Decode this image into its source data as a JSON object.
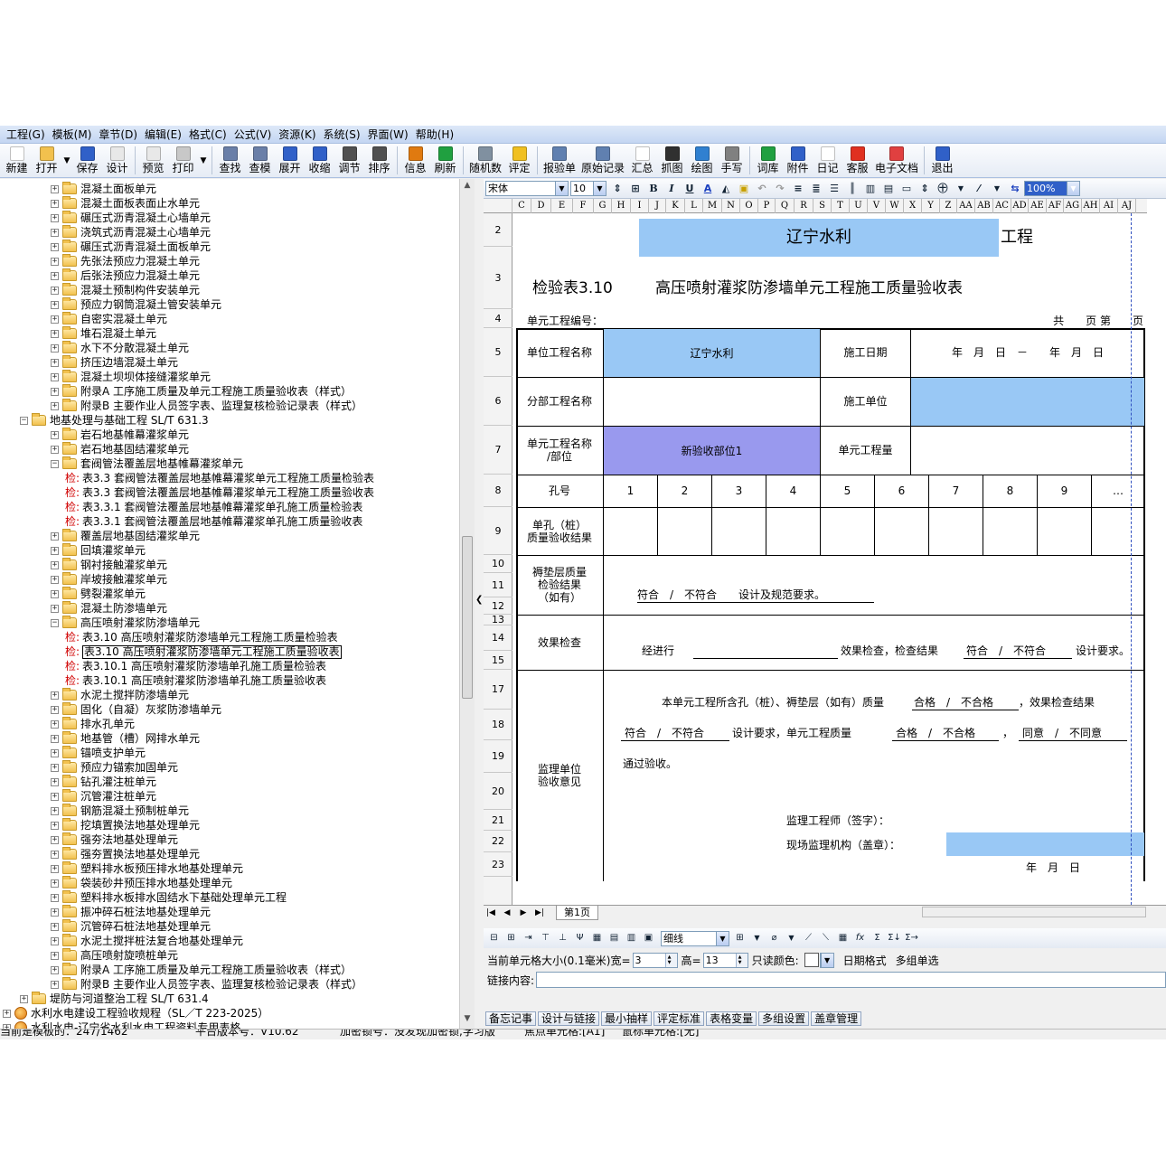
{
  "menu": [
    "工程(G)",
    "模板(M)",
    "章节(D)",
    "编辑(E)",
    "格式(C)",
    "公式(V)",
    "资源(K)",
    "系统(S)",
    "界面(W)",
    "帮助(H)"
  ],
  "toolbar": {
    "new": "新建",
    "open": "打开",
    "save": "保存",
    "design": "设计",
    "preview": "预览",
    "print": "打印",
    "find": "查找",
    "check_tpl": "查模",
    "expand": "展开",
    "collapse": "收缩",
    "adjust": "调节",
    "sort": "排序",
    "info": "信息",
    "refresh": "刷新",
    "random": "随机数",
    "evaluate": "评定",
    "report": "报验单",
    "raw_record": "原始记录",
    "summary": "汇总",
    "capture": "抓图",
    "draw": "绘图",
    "handwrite": "手写",
    "lexicon": "词库",
    "attach": "附件",
    "diary": "日记",
    "service": "客服",
    "edoc": "电子文档",
    "exit": "退出"
  },
  "tree": [
    {
      "indent": 1,
      "type": "folder",
      "text": "混凝土面板单元"
    },
    {
      "indent": 1,
      "type": "folder",
      "text": "混凝土面板表面止水单元"
    },
    {
      "indent": 1,
      "type": "folder",
      "text": "碾压式沥青混凝土心墙单元"
    },
    {
      "indent": 1,
      "type": "folder",
      "text": "浇筑式沥青混凝土心墙单元"
    },
    {
      "indent": 1,
      "type": "folder",
      "text": "碾压式沥青混凝土面板单元"
    },
    {
      "indent": 1,
      "type": "folder",
      "text": "先张法预应力混凝土单元"
    },
    {
      "indent": 1,
      "type": "folder",
      "text": "后张法预应力混凝土单元"
    },
    {
      "indent": 1,
      "type": "folder",
      "text": "混凝土预制构件安装单元"
    },
    {
      "indent": 1,
      "type": "folder",
      "text": "预应力钢筒混凝土管安装单元"
    },
    {
      "indent": 1,
      "type": "folder",
      "text": "自密实混凝土单元"
    },
    {
      "indent": 1,
      "type": "folder",
      "text": "堆石混凝土单元"
    },
    {
      "indent": 1,
      "type": "folder",
      "text": "水下不分散混凝土单元"
    },
    {
      "indent": 1,
      "type": "folder",
      "text": "挤压边墙混凝土单元"
    },
    {
      "indent": 1,
      "type": "folder",
      "text": "混凝土坝坝体接缝灌浆单元"
    },
    {
      "indent": 1,
      "type": "folder",
      "text": "附录A 工序施工质量及单元工程施工质量验收表（样式）"
    },
    {
      "indent": 1,
      "type": "folder",
      "text": "附录B 主要作业人员签字表、监理复核检验记录表（样式）"
    },
    {
      "indent": 0,
      "type": "folder-open",
      "text": "地基处理与基础工程 SL/T 631.3"
    },
    {
      "indent": 1,
      "type": "folder",
      "text": "岩石地基帷幕灌浆单元"
    },
    {
      "indent": 1,
      "type": "folder",
      "text": "岩石地基固结灌浆单元"
    },
    {
      "indent": 1,
      "type": "folder-open",
      "text": "套阀管法覆盖层地基帷幕灌浆单元"
    },
    {
      "indent": 2,
      "type": "leaf",
      "prefix": "检:",
      "text": "表3.3 套阀管法覆盖层地基帷幕灌浆单元工程施工质量检验表"
    },
    {
      "indent": 2,
      "type": "leaf",
      "prefix": "检:",
      "text": "表3.3 套阀管法覆盖层地基帷幕灌浆单元工程施工质量验收表"
    },
    {
      "indent": 2,
      "type": "leaf",
      "prefix": "检:",
      "text": "表3.3.1 套阀管法覆盖层地基帷幕灌浆单孔施工质量检验表"
    },
    {
      "indent": 2,
      "type": "leaf",
      "prefix": "检:",
      "text": "表3.3.1 套阀管法覆盖层地基帷幕灌浆单孔施工质量验收表"
    },
    {
      "indent": 1,
      "type": "folder",
      "text": "覆盖层地基固结灌浆单元"
    },
    {
      "indent": 1,
      "type": "folder",
      "text": "回填灌浆单元"
    },
    {
      "indent": 1,
      "type": "folder",
      "text": "钢衬接触灌浆单元"
    },
    {
      "indent": 1,
      "type": "folder",
      "text": "岸坡接触灌浆单元"
    },
    {
      "indent": 1,
      "type": "folder",
      "text": "劈裂灌浆单元"
    },
    {
      "indent": 1,
      "type": "folder",
      "text": "混凝土防渗墙单元"
    },
    {
      "indent": 1,
      "type": "folder-open",
      "text": "高压喷射灌浆防渗墙单元"
    },
    {
      "indent": 2,
      "type": "leaf",
      "prefix": "检:",
      "text": "表3.10 高压喷射灌浆防渗墙单元工程施工质量检验表"
    },
    {
      "indent": 2,
      "type": "leaf",
      "prefix": "检:",
      "text": "表3.10 高压喷射灌浆防渗墙单元工程施工质量验收表",
      "selected": true
    },
    {
      "indent": 2,
      "type": "leaf",
      "prefix": "检:",
      "text": "表3.10.1 高压喷射灌浆防渗墙单孔施工质量检验表"
    },
    {
      "indent": 2,
      "type": "leaf",
      "prefix": "检:",
      "text": "表3.10.1 高压喷射灌浆防渗墙单孔施工质量验收表"
    },
    {
      "indent": 1,
      "type": "folder",
      "text": "水泥土搅拌防渗墙单元"
    },
    {
      "indent": 1,
      "type": "folder",
      "text": "固化（自凝）灰浆防渗墙单元"
    },
    {
      "indent": 1,
      "type": "folder",
      "text": "排水孔单元"
    },
    {
      "indent": 1,
      "type": "folder",
      "text": "地基管（槽）网排水单元"
    },
    {
      "indent": 1,
      "type": "folder",
      "text": "锚喷支护单元"
    },
    {
      "indent": 1,
      "type": "folder",
      "text": "预应力锚索加固单元"
    },
    {
      "indent": 1,
      "type": "folder",
      "text": "钻孔灌注桩单元"
    },
    {
      "indent": 1,
      "type": "folder",
      "text": "沉管灌注桩单元"
    },
    {
      "indent": 1,
      "type": "folder",
      "text": "钢筋混凝土预制桩单元"
    },
    {
      "indent": 1,
      "type": "folder",
      "text": "挖填置换法地基处理单元"
    },
    {
      "indent": 1,
      "type": "folder",
      "text": "强夯法地基处理单元"
    },
    {
      "indent": 1,
      "type": "folder",
      "text": "强夯置换法地基处理单元"
    },
    {
      "indent": 1,
      "type": "folder",
      "text": "塑料排水板预压排水地基处理单元"
    },
    {
      "indent": 1,
      "type": "folder",
      "text": "袋装砂井预压排水地基处理单元"
    },
    {
      "indent": 1,
      "type": "folder",
      "text": "塑料排水板排水固结水下基础处理单元工程"
    },
    {
      "indent": 1,
      "type": "folder",
      "text": "振冲碎石桩法地基处理单元"
    },
    {
      "indent": 1,
      "type": "folder",
      "text": "沉管碎石桩法地基处理单元"
    },
    {
      "indent": 1,
      "type": "folder",
      "text": "水泥土搅拌桩法复合地基处理单元"
    },
    {
      "indent": 1,
      "type": "folder",
      "text": "高压喷射旋喷桩单元"
    },
    {
      "indent": 1,
      "type": "folder",
      "text": "附录A 工序施工质量及单元工程施工质量验收表（样式）"
    },
    {
      "indent": 1,
      "type": "folder",
      "text": "附录B 主要作业人员签字表、监理复核检验记录表（样式）"
    },
    {
      "indent": 0,
      "type": "folder",
      "text": "堤防与河道整治工程 SL/T 631.4"
    },
    {
      "indent": -1,
      "type": "globe",
      "text": "水利水电建设工程验收规程（SL／T 223-2025）"
    },
    {
      "indent": -1,
      "type": "globe",
      "text": "水利水电-辽宁省水利水电工程资料专用表格"
    }
  ],
  "format_bar": {
    "font": "宋体",
    "size": "10",
    "zoom": "100%"
  },
  "columns": [
    "C",
    "D",
    "E",
    "F",
    "G",
    "H",
    "I",
    "J",
    "K",
    "L",
    "M",
    "N",
    "O",
    "P",
    "Q",
    "R",
    "S",
    "T",
    "U",
    "V",
    "W",
    "X",
    "Y",
    "Z",
    "AA",
    "AB",
    "AC",
    "AD",
    "AE",
    "AF",
    "AG",
    "AH",
    "AI",
    "AJ"
  ],
  "rows": [
    "2",
    "3",
    "4",
    "5",
    "6",
    "7",
    "8",
    "9",
    "10",
    "11",
    "12",
    "13",
    "14",
    "15",
    "17",
    "18",
    "19",
    "20",
    "21",
    "22",
    "23"
  ],
  "form": {
    "header_name": "辽宁水利",
    "header_suffix": "工程",
    "title_no": "检验表3.10",
    "title": "高压喷射灌浆防渗墙单元工程施工质量验收表",
    "unit_no_label": "单元工程编号：",
    "page_label": "共　　页 第　　页",
    "unit_project_label": "单位工程名称",
    "unit_project_value": "辽宁水利",
    "construction_date_label": "施工日期",
    "construction_date_value": "年　月　日　－　　年　月　日",
    "sub_project_label": "分部工程名称",
    "contractor_label": "施工单位",
    "element_label": "单元工程名称\n/部位",
    "element_value": "新验收部位1",
    "quantity_label": "单元工程量",
    "hole_label": "孔号",
    "holes": [
      "1",
      "2",
      "3",
      "4",
      "5",
      "6",
      "7",
      "8",
      "9",
      "…"
    ],
    "single_hole_label": "单孔（桩）\n质量验收结果",
    "cushion_label": "褥垫层质量\n检验结果\n（如有）",
    "cushion_text": "符合　/　不符合　　设计及规范要求。",
    "effect_label": "效果检查",
    "effect_text_1": "经进行",
    "effect_text_2": "效果检查，检查结果",
    "effect_text_3": "符合　/　不符合",
    "effect_text_4": "设计要求。",
    "supervisor_label": "监理单位\n验收意见",
    "opinion_1a": "本单元工程所含孔（桩）、褥垫层（如有）质量",
    "opinion_1b": "合格　/　不合格",
    "opinion_1c": "，效果检查结果",
    "opinion_2a": "符合　/　不符合",
    "opinion_2b": "设计要求，单元工程质量",
    "opinion_2c": "合格　/　不合格",
    "opinion_2d": "，",
    "opinion_2e": "同意　/　不同意",
    "opinion_3": "通过验收。",
    "engineer_sign": "监理工程师（签字）：",
    "org_seal": "现场监理机构（盖章）：",
    "date": "年　月　日"
  },
  "sheet_tab": "第1页",
  "bottom_bar": {
    "line_style": "细线"
  },
  "size_bar": {
    "label": "当前单元格大小(0.1毫米)宽=",
    "width": "3",
    "height_label": "高=",
    "height": "13",
    "readonly": "只读颜色:",
    "date_fmt": "日期格式",
    "multi": "多组单选"
  },
  "link_label": "链接内容:",
  "panel_tabs": [
    "备忘记事",
    "设计与链接",
    "最小抽样",
    "评定标准",
    "表格变量",
    "多组设置",
    "盖章管理"
  ],
  "status": {
    "tpl": "当前是模板的：247/1462",
    "ver": "平台版本号：V10.62",
    "enc": "加密锁号：没发现加密锁,学习版",
    "focus": "焦点单元格:[A1]",
    "range": "鼠标单元格:[无]"
  }
}
